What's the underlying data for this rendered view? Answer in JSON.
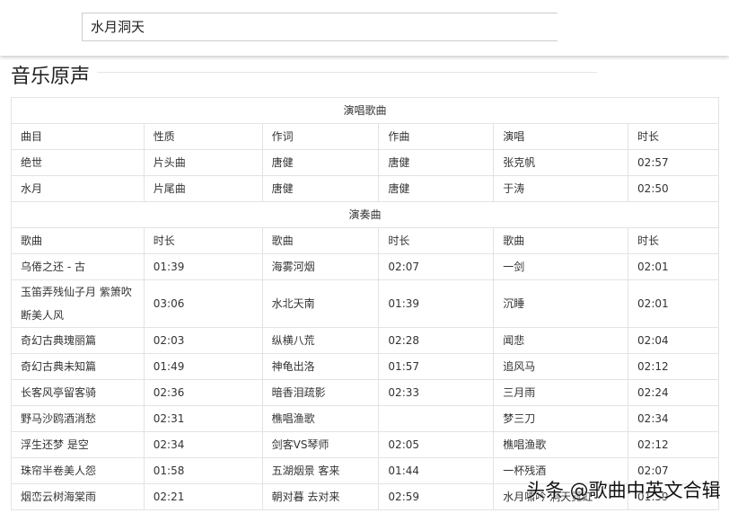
{
  "search": {
    "value": "水月洞天"
  },
  "section_title": "音乐原声",
  "vocal": {
    "title": "演唱歌曲",
    "headers": [
      "曲目",
      "性质",
      "作词",
      "作曲",
      "演唱",
      "时长"
    ],
    "rows": [
      [
        "绝世",
        "片头曲",
        "唐健",
        "唐健",
        "张克帆",
        "02:57"
      ],
      [
        "水月",
        "片尾曲",
        "唐健",
        "唐健",
        "于涛",
        "02:50"
      ]
    ]
  },
  "instrumental": {
    "title": "演奏曲",
    "headers": [
      "歌曲",
      "时长",
      "歌曲",
      "时长",
      "歌曲",
      "时长"
    ],
    "rows": [
      [
        "乌倦之还 - 古",
        "01:39",
        "海雾河烟",
        "02:07",
        "一剑",
        "02:01"
      ],
      [
        "玉笛弄残仙子月 紫箫吹断美人风",
        "03:06",
        "水北天南",
        "01:39",
        "沉睡",
        "02:01"
      ],
      [
        "奇幻古典瑰丽篇",
        "02:03",
        "纵横八荒",
        "02:28",
        "闻悲",
        "02:04"
      ],
      [
        "奇幻古典未知篇",
        "01:49",
        "神龟出洛",
        "01:57",
        "追风马",
        "02:12"
      ],
      [
        "长客风亭留客骑",
        "02:36",
        "暗香泪疏影",
        "02:33",
        "三月雨",
        "02:24"
      ],
      [
        "野马沙鸥酒消愁",
        "02:31",
        "樵唱渔歌",
        "",
        "梦三刀",
        "02:34"
      ],
      [
        "浮生还梦 是空",
        "02:34",
        "剑客VS琴师",
        "02:05",
        "樵唱渔歌",
        "02:12"
      ],
      [
        "珠帘半卷美人怨",
        "01:58",
        "五湖烟景 客来",
        "01:44",
        "一杯残酒",
        "02:07"
      ],
      [
        "烟峦云树海棠雨",
        "02:21",
        "朝对暮 去对来",
        "02:59",
        "水月啸吟 洞天霓虹",
        "01:59"
      ]
    ]
  },
  "watermark": "头条 @歌曲中英文合辑"
}
